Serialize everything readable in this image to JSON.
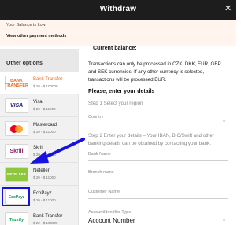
{
  "header": {
    "title": "Withdraw",
    "close_icon": "close-icon"
  },
  "banner": {
    "low_balance": "Your Balance is Low!",
    "view_other": "View other payment methods"
  },
  "sidebar": {
    "heading": "Other options",
    "options": [
      {
        "logo": "BANK TRANSFER",
        "name": "Bank Transfer",
        "range": "$ 20 - $ 100000",
        "active": true
      },
      {
        "logo": "VISA",
        "name": "Visa",
        "range": "$ 20 - $ 11000"
      },
      {
        "logo": "mastercard",
        "name": "Mastercard",
        "range": "$ 20 - $ 11000"
      },
      {
        "logo": "Skrill",
        "name": "Skrill",
        "range": "$ 20 - $ 11000"
      },
      {
        "logo": "NETELLER",
        "name": "Neteller",
        "range": "$ 20 - $ 11000"
      },
      {
        "logo": "EcoPayz",
        "name": "EcoPayz",
        "range": "$ 20 - $ 11000"
      },
      {
        "logo": "Trustly",
        "name": "Bank Transfer",
        "range": "$ 20 - $ 100000"
      }
    ]
  },
  "main": {
    "balance_label": "Current balance:",
    "currency_note_1": "Transactions can only be processed in CZK, DKK, EUR, GBP",
    "currency_note_2": "and SEK currencies. If any other currency is selected,",
    "currency_note_3": "transactions will be processed EUR.",
    "enter_details": "Please, enter your details",
    "step1": "Step 1 Select your region",
    "country_label": "Country",
    "step2_1": "Step 2 Enter your details – Your IBAN, BIC/Swift and other",
    "step2_2": "banking details can be obtained by contacting your bank.",
    "bank_name": "Bank Name",
    "branch_name": "Branch name",
    "customer_name": "Customer Name",
    "account_id_type": "AccountIdentifier Type",
    "account_number": "Account Number"
  },
  "colors": {
    "accent": "#e86a1f",
    "highlight": "#1612e0",
    "topbar": "#1d1d1d"
  }
}
